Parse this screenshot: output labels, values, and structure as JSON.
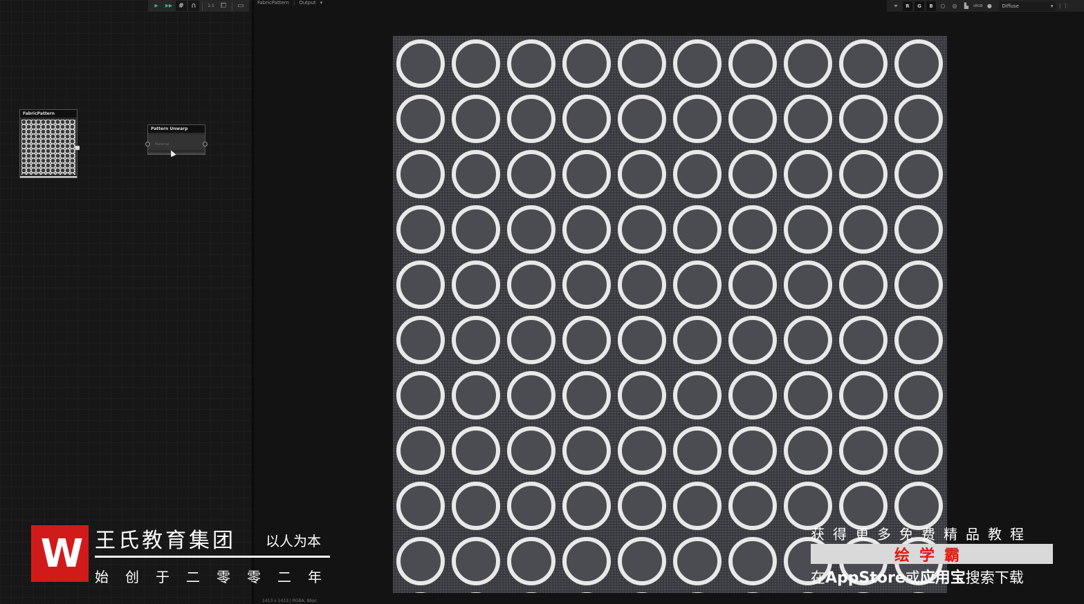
{
  "graph": {
    "toolbar": {
      "icons": [
        "play-icon",
        "play-all-icon",
        "grid-icon",
        "magnet-icon",
        "one-to-one-icon",
        "frame-icon",
        "window-icon"
      ],
      "one_to_one_label": "1:1"
    },
    "nodes": [
      {
        "title": "FabricPattern"
      },
      {
        "title": "Pattern Unwarp",
        "field": "Material"
      }
    ]
  },
  "viewer": {
    "breadcrumb": {
      "item1": "FabricPattern",
      "separator": "|",
      "item2": "Output"
    },
    "toolbar": {
      "channels": [
        "R",
        "G",
        "B"
      ],
      "color_space": "sRGB",
      "channel_select": "Diffuse"
    },
    "status": "1413 x 1413 | RGBA, 8bpc"
  },
  "watermark": {
    "logo_letter": "W",
    "org_name": "王氏教育集团",
    "slogan": "以人为本",
    "founded": "始创于二零零二年",
    "promo_line1": "获得更多免费精品教程",
    "promo_brand": "绘学霸",
    "promo_line3_prefix": "在",
    "promo_line3_store1": "AppStore",
    "promo_line3_mid": "或",
    "promo_line3_store2": "应用宝",
    "promo_line3_suffix": "搜索下载"
  },
  "colors": {
    "accent_green": "#3fb58a",
    "logo_red": "#d11b1b",
    "brand_red": "#e01818"
  }
}
